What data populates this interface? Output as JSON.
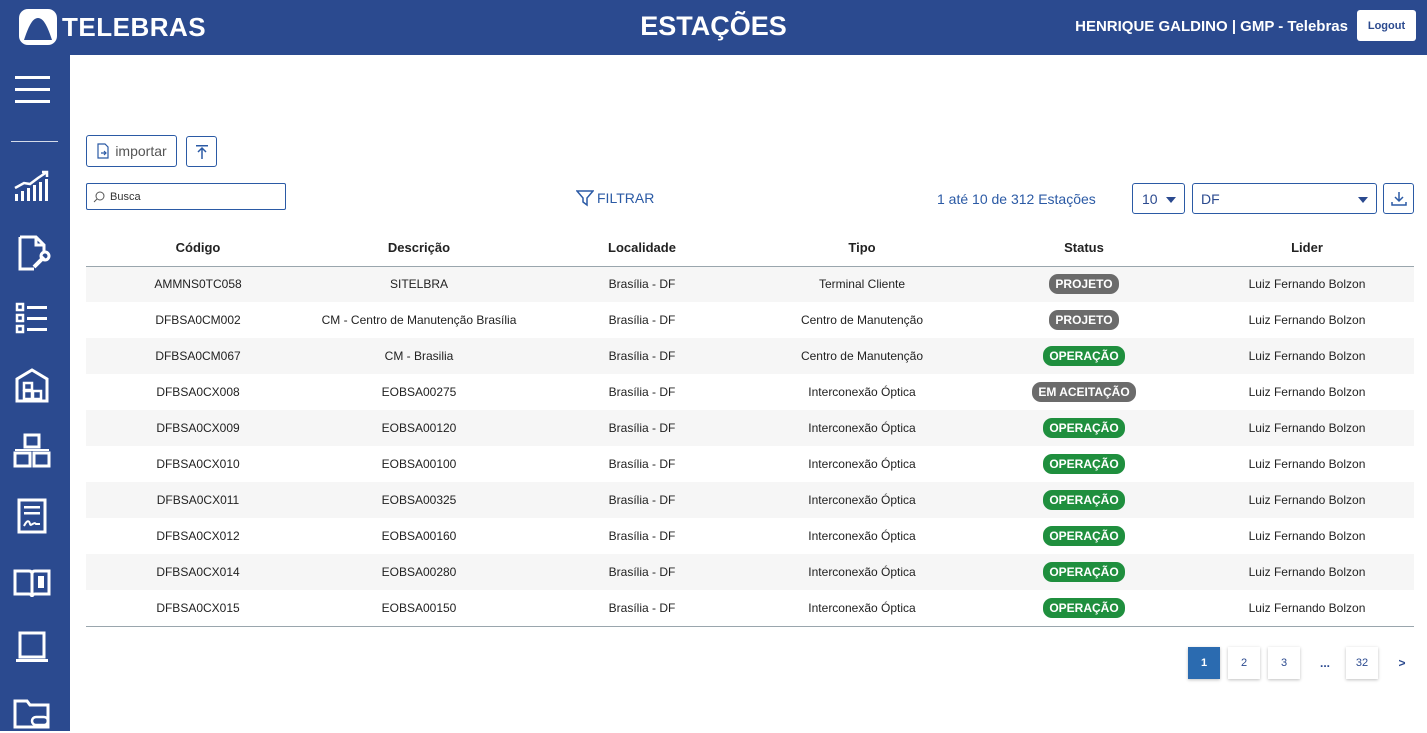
{
  "header": {
    "logo_text": "TELEBRAS",
    "title": "ESTAÇÕES",
    "user": "HENRIQUE GALDINO | GMP - Telebras",
    "logout_label": "Logout"
  },
  "sidebar": {
    "items": [
      "menu-icon",
      "chart-icon",
      "document-wrench-icon",
      "list-icon",
      "warehouse-icon",
      "boxes-icon",
      "form-icon",
      "manual-icon",
      "laptop-icon",
      "folder-link-icon"
    ]
  },
  "toolbar": {
    "import_label": "importar",
    "search_placeholder": "Busca",
    "filter_label": "FILTRAR",
    "count_text": "1 até 10 de 312 Estações",
    "per_page": "10",
    "uf": "DF"
  },
  "table": {
    "headers": [
      "Código",
      "Descrição",
      "Localidade",
      "Tipo",
      "Status",
      "Lider"
    ],
    "rows": [
      {
        "codigo": "AMMNS0TC058",
        "descricao": "SITELBRA",
        "localidade": "Brasília - DF",
        "tipo": "Terminal Cliente",
        "status": "PROJETO",
        "status_color": "#6b6b6b",
        "lider": "Luiz Fernando Bolzon"
      },
      {
        "codigo": "DFBSA0CM002",
        "descricao": "CM - Centro de Manutenção Brasília",
        "localidade": "Brasília - DF",
        "tipo": "Centro de Manutenção",
        "status": "PROJETO",
        "status_color": "#6b6b6b",
        "lider": "Luiz Fernando Bolzon"
      },
      {
        "codigo": "DFBSA0CM067",
        "descricao": "CM - Brasilia",
        "localidade": "Brasília - DF",
        "tipo": "Centro de Manutenção",
        "status": "OPERAÇÃO",
        "status_color": "#1f8f3e",
        "lider": "Luiz Fernando Bolzon"
      },
      {
        "codigo": "DFBSA0CX008",
        "descricao": "EOBSA00275",
        "localidade": "Brasília - DF",
        "tipo": "Interconexão Óptica",
        "status": "EM ACEITAÇÃO",
        "status_color": "#6b6b6b",
        "lider": "Luiz Fernando Bolzon"
      },
      {
        "codigo": "DFBSA0CX009",
        "descricao": "EOBSA00120",
        "localidade": "Brasília - DF",
        "tipo": "Interconexão Óptica",
        "status": "OPERAÇÃO",
        "status_color": "#1f8f3e",
        "lider": "Luiz Fernando Bolzon"
      },
      {
        "codigo": "DFBSA0CX010",
        "descricao": "EOBSA00100",
        "localidade": "Brasília - DF",
        "tipo": "Interconexão Óptica",
        "status": "OPERAÇÃO",
        "status_color": "#1f8f3e",
        "lider": "Luiz Fernando Bolzon"
      },
      {
        "codigo": "DFBSA0CX011",
        "descricao": "EOBSA00325",
        "localidade": "Brasília - DF",
        "tipo": "Interconexão Óptica",
        "status": "OPERAÇÃO",
        "status_color": "#1f8f3e",
        "lider": "Luiz Fernando Bolzon"
      },
      {
        "codigo": "DFBSA0CX012",
        "descricao": "EOBSA00160",
        "localidade": "Brasília - DF",
        "tipo": "Interconexão Óptica",
        "status": "OPERAÇÃO",
        "status_color": "#1f8f3e",
        "lider": "Luiz Fernando Bolzon"
      },
      {
        "codigo": "DFBSA0CX014",
        "descricao": "EOBSA00280",
        "localidade": "Brasília - DF",
        "tipo": "Interconexão Óptica",
        "status": "OPERAÇÃO",
        "status_color": "#1f8f3e",
        "lider": "Luiz Fernando Bolzon"
      },
      {
        "codigo": "DFBSA0CX015",
        "descricao": "EOBSA00150",
        "localidade": "Brasília - DF",
        "tipo": "Interconexão Óptica",
        "status": "OPERAÇÃO",
        "status_color": "#1f8f3e",
        "lider": "Luiz Fernando Bolzon"
      }
    ]
  },
  "pagination": {
    "pages": [
      "1",
      "2",
      "3"
    ],
    "ellipsis": "...",
    "last": "32",
    "next": ">",
    "current": "1"
  },
  "colors": {
    "brand": "#2b4a8f",
    "accent": "#2b5aa5",
    "status_operation": "#1f8f3e",
    "status_project": "#6b6b6b"
  }
}
